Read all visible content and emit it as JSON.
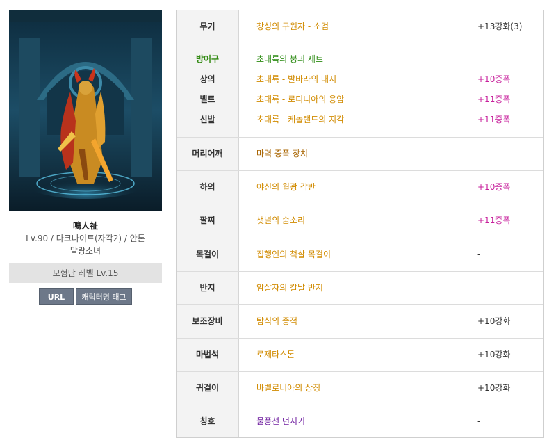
{
  "profile": {
    "name": "鳴人祉",
    "info_line1": "Lv.90 / 다크나이트(자각2) / 안톤",
    "info_line2": "말랑소녀",
    "guild": "모험단 레벨 Lv.15",
    "buttons": {
      "url": "URL",
      "tag": "캐릭터명 태그"
    }
  },
  "equipment": {
    "weapon": {
      "slot": "무기",
      "name": "창성의 구원자 - 소검",
      "enhance": "+13강화(3)"
    },
    "armor_set": {
      "slot": "방어구",
      "name": "초대륙의 붕괴 세트"
    },
    "top": {
      "slot": "상의",
      "name": "초대륙 - 발바라의 대지",
      "enhance": "+10증폭"
    },
    "belt": {
      "slot": "벨트",
      "name": "초대륙 - 로디니아의 융암",
      "enhance": "+11증폭"
    },
    "shoes": {
      "slot": "신발",
      "name": "초대륙 - 케놀랜드의 지각",
      "enhance": "+11증폭"
    },
    "shoulder": {
      "slot": "머리어깨",
      "name": "마력 증폭 장치",
      "enhance": "-"
    },
    "bottom": {
      "slot": "하의",
      "name": "야신의 월광 각반",
      "enhance": "+10증폭"
    },
    "bracelet": {
      "slot": "팔찌",
      "name": "샛별의 숨소리",
      "enhance": "+11증폭"
    },
    "necklace": {
      "slot": "목걸이",
      "name": "집행인의 척살 목걸이",
      "enhance": "-"
    },
    "ring": {
      "slot": "반지",
      "name": "암살자의 칼날 반지",
      "enhance": "-"
    },
    "support": {
      "slot": "보조장비",
      "name": "탐식의 증적",
      "enhance": "+10강화"
    },
    "magic_stone": {
      "slot": "마법석",
      "name": "로제타스톤",
      "enhance": "+10강화"
    },
    "earring": {
      "slot": "귀걸이",
      "name": "바벨로니아의 상징",
      "enhance": "+10강화"
    },
    "title": {
      "slot": "칭호",
      "name": "물풍선 던지기",
      "enhance": "-"
    }
  },
  "colors": {
    "rare_item": "#b8860b",
    "set_name": "#2b8a12",
    "amplify": "#c71f9b",
    "title_item": "#6e1d9f",
    "button_bg": "#6d7889"
  },
  "icons": {
    "portrait": "character-portrait"
  }
}
